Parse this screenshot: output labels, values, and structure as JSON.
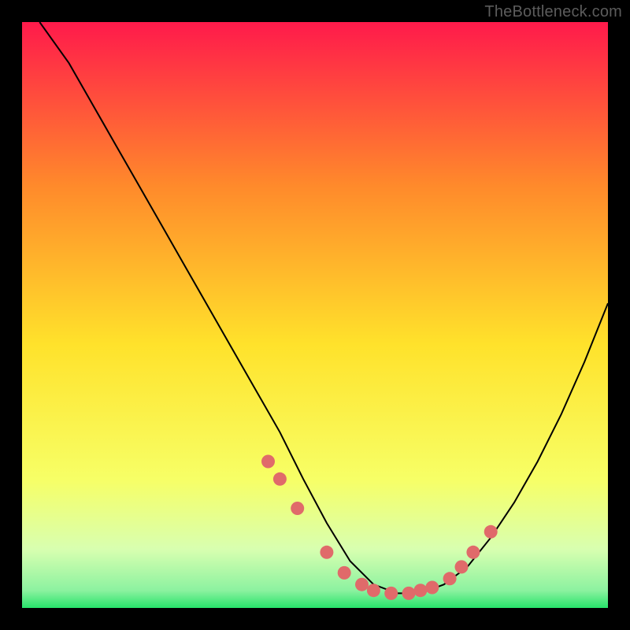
{
  "watermark": "TheBottleneck.com",
  "colors": {
    "frame": "#000000",
    "watermark_text": "#5c5c5c",
    "curve": "#000000",
    "dot_fill": "#e06a6a",
    "gradient_top": "#ff1a4b",
    "gradient_mid1": "#ff8a2b",
    "gradient_mid2": "#ffe22b",
    "gradient_low": "#f7ff66",
    "gradient_bottom_pale": "#d8ffb0",
    "gradient_bottom": "#27e36a"
  },
  "chart_data": {
    "type": "line",
    "title": "",
    "xlabel": "",
    "ylabel": "",
    "xlim": [
      0,
      100
    ],
    "ylim": [
      0,
      100
    ],
    "series": [
      {
        "name": "bottleneck-curve",
        "x": [
          3,
          8,
          12,
          16,
          20,
          24,
          28,
          32,
          36,
          40,
          44,
          48,
          52,
          56,
          60,
          64,
          68,
          72,
          76,
          80,
          84,
          88,
          92,
          96,
          100
        ],
        "y": [
          100,
          93,
          86,
          79,
          72,
          65,
          58,
          51,
          44,
          37,
          30,
          22,
          14.5,
          8,
          4,
          2.5,
          2.5,
          4,
          7,
          12,
          18,
          25,
          33,
          42,
          52
        ]
      }
    ],
    "dots": {
      "name": "highlighted-points",
      "x": [
        42,
        44,
        47,
        52,
        55,
        58,
        60,
        63,
        66,
        68,
        70,
        73,
        75,
        77,
        80
      ],
      "y": [
        25,
        22,
        17,
        9.5,
        6,
        4,
        3,
        2.5,
        2.5,
        3,
        3.5,
        5,
        7,
        9.5,
        13
      ]
    }
  }
}
